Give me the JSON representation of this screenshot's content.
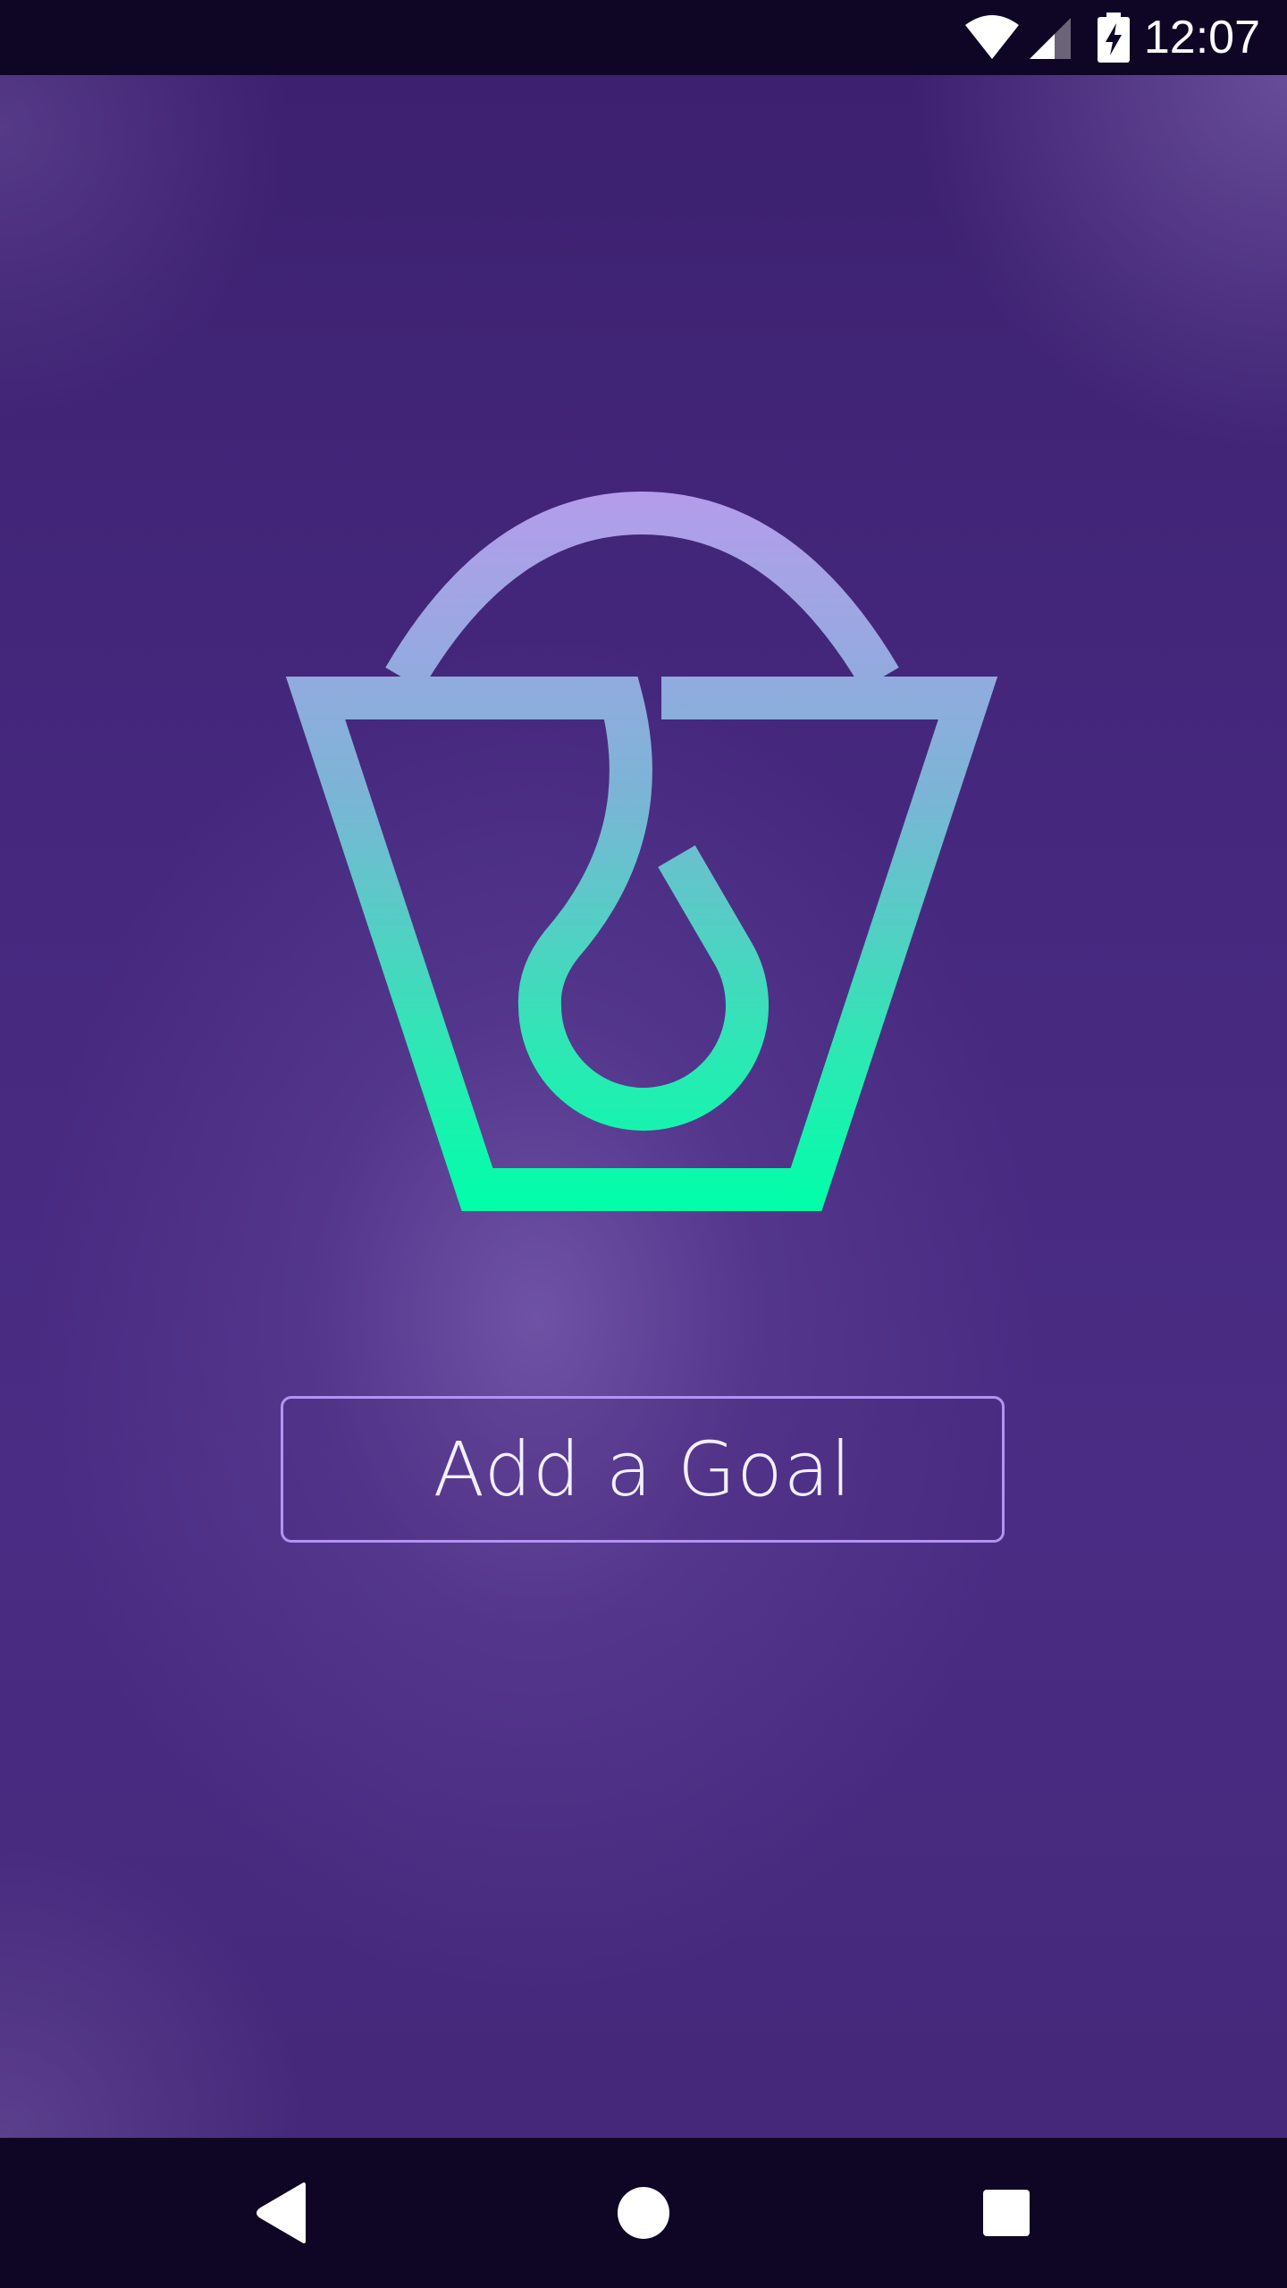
{
  "status_bar": {
    "time": "12:07",
    "icons": [
      "wifi-icon",
      "cell-signal-icon",
      "battery-charging-icon"
    ]
  },
  "main": {
    "logo": "bucket-drop-logo",
    "add_goal_label": "Add a Goal"
  },
  "nav_bar": {
    "icons": [
      "back-icon",
      "home-icon",
      "recents-icon"
    ]
  },
  "colors": {
    "system_bar": "#0f0626",
    "background": "#46277d",
    "logo_gradient_top": "#b59cec",
    "logo_gradient_bottom": "#00ffa8",
    "button_border": "#b592f2"
  }
}
